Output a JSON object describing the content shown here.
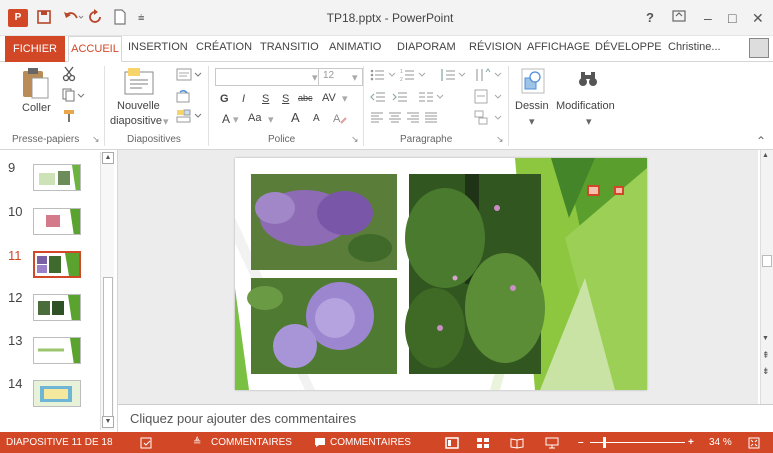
{
  "app": {
    "title": "TP18.pptx - PowerPoint",
    "logo": "P",
    "brand_color": "#d24726"
  },
  "quick_access": {
    "save_icon": "save-icon",
    "undo_icon": "undo-icon",
    "redo_icon": "redo-icon",
    "new_icon": "new-document-icon"
  },
  "window_controls": {
    "help": "?",
    "minimize": "–",
    "maximize": "□",
    "close": "✕"
  },
  "tabs": [
    {
      "label": "FICHIER"
    },
    {
      "label": "ACCUEIL"
    },
    {
      "label": "INSERTION"
    },
    {
      "label": "CRÉATION"
    },
    {
      "label": "TRANSITIO"
    },
    {
      "label": "ANIMATIO"
    },
    {
      "label": "DIAPORAM"
    },
    {
      "label": "RÉVISION"
    },
    {
      "label": "AFFICHAGE"
    },
    {
      "label": "DÉVELOPPE"
    }
  ],
  "user": {
    "name": "Christine..."
  },
  "ribbon": {
    "paste_label": "Coller",
    "new_slide_label_1": "Nouvelle",
    "new_slide_label_2": "diapositive",
    "font_size": "12",
    "drawing_label": "Dessin",
    "editing_label": "Modification",
    "groups": {
      "clipboard": "Presse-papiers",
      "slides": "Diapositives",
      "font": "Police",
      "paragraph": "Paragraphe"
    },
    "font_letters": {
      "bold": "G",
      "italic": "I",
      "underline": "S",
      "shadow": "S",
      "strike": "abc",
      "spacing": "AV",
      "color": "A",
      "size_aa": "Aa",
      "grow": "A",
      "shrink": "A"
    }
  },
  "thumbnails": {
    "numbers": [
      "9",
      "10",
      "11",
      "12",
      "13",
      "14"
    ],
    "selected": "11"
  },
  "notes": {
    "placeholder": "Cliquez pour ajouter des commentaires"
  },
  "status": {
    "slide": "DIAPOSITIVE 11 DE 18",
    "notes_button": "COMMENTAIRES",
    "comments_button": "COMMENTAIRES",
    "zoom": "34 %",
    "zoom_level": 0.34
  }
}
